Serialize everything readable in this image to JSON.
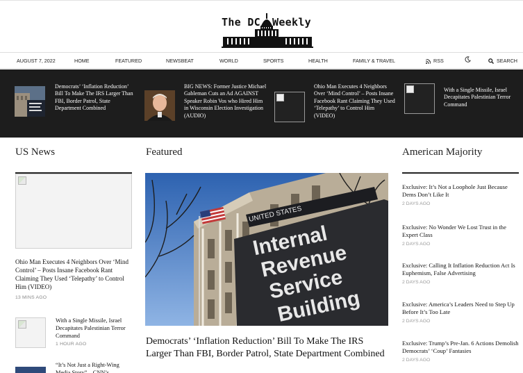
{
  "masthead": {
    "logo_left": "The DC",
    "logo_right": "Weekly"
  },
  "nav": {
    "date": "AUGUST 7, 2022",
    "items": [
      "HOME",
      "FEATURED",
      "NEWSBEAT",
      "WORLD",
      "SPORTS",
      "HEALTH",
      "FAMILY & TRAVEL"
    ],
    "rss": "RSS",
    "search": "SEARCH",
    "icons": {
      "rss": "rss-icon",
      "theme": "moon-icon",
      "search": "search-icon"
    }
  },
  "trending": [
    {
      "title": "Democrats’ ‘Inflation Reduction’ Bill To Make The IRS Larger Than FBI, Border Patrol, State Department Combined",
      "thumb": "irs-building-thumbnail"
    },
    {
      "title": "BIG NEWS: Former Justice Michael Gableman Cuts an Ad AGAINST Speaker Robin Vos who Hired Him in Wisconsin Election Investigation (AUDIO)",
      "thumb": "portrait-thumbnail"
    },
    {
      "title": "Ohio Man Executes 4 Neighbors Over ‘Mind Control’ – Posts Insane Facebook Rant Claiming They Used ‘Telepathy’ to Control Him (VIDEO)",
      "thumb": "broken-image"
    },
    {
      "title": "With a Single Missile, Israel Decapitates Palestinian Terror Command",
      "thumb": "broken-image"
    }
  ],
  "us_news": {
    "title": "US News",
    "lead": {
      "headline": "Ohio Man Executes 4 Neighbors Over ‘Mind Control’ – Posts Insane Facebook Rant Claiming They Used ‘Telepathy’ to Control Him (VIDEO)",
      "time": "13 MINS AGO"
    },
    "items": [
      {
        "headline": "With a Single Missile, Israel Decapitates Palestinian Terror Command",
        "time": "1 HOUR AGO"
      },
      {
        "headline": "“It’s Not Just a Right-Wing Media Story” – CNN’s",
        "time": ""
      }
    ]
  },
  "featured": {
    "title": "Featured",
    "sign_top": "UNITED STATES",
    "sign_lines": [
      "Internal",
      "Revenue",
      "Service",
      "Building"
    ],
    "headline": "Democrats’ ‘Inflation Reduction’ Bill To Make The IRS Larger Than FBI, Border Patrol, State Department Combined"
  },
  "american_majority": {
    "title": "American Majority",
    "items": [
      {
        "headline": "Exclusive: It’s Not a Loophole Just Because Dems Don’t Like It",
        "time": "2 DAYS AGO"
      },
      {
        "headline": "Exclusive: No Wonder We Lost Trust in the Expert Class",
        "time": "2 DAYS AGO"
      },
      {
        "headline": "Exclusive: Calling It Inflation Reduction Act Is Euphemism, False Advertising",
        "time": "2 DAYS AGO"
      },
      {
        "headline": "Exclusive: America’s Leaders Need to Step Up Before It’s Too Late",
        "time": "2 DAYS AGO"
      },
      {
        "headline": "Exclusive: Trump’s Pre-Jan. 6 Actions Demolish Democrats’ ‘Coup’ Fantasies",
        "time": "2 DAYS AGO"
      }
    ]
  }
}
